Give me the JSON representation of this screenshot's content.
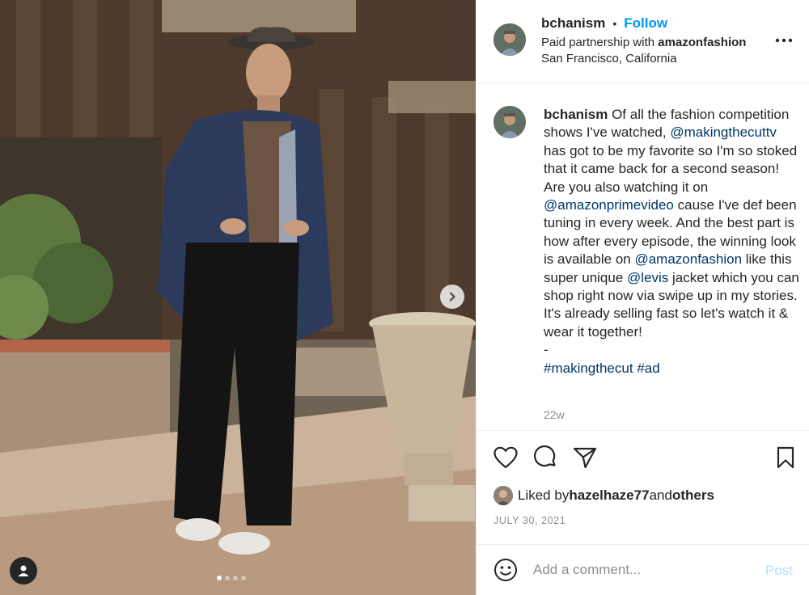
{
  "post": {
    "username": "bchanism",
    "separator": "•",
    "follow_label": "Follow",
    "partnership_prefix": "Paid partnership with ",
    "partner": "amazonfashion",
    "location": "San Francisco, California",
    "more_icon": "more-horizontal-icon"
  },
  "caption": {
    "username": "bchanism",
    "text_1": " Of all the fashion competition shows I've watched, ",
    "mention_1": "@makingthecuttv",
    "text_2": " has got to be my favorite so I'm so stoked that it came back for a second season! Are you also watching it on ",
    "mention_2": "@amazonprimevideo",
    "text_3": " cause I've def been tuning in every week. And the best part is how after every episode, the winning look is available on ",
    "mention_3": "@amazonfashion",
    "text_4": " like this super unique ",
    "mention_4": "@levis",
    "text_5": " jacket which you can shop right now via swipe up in my stories. It's already selling fast so let's watch it & wear it together!",
    "dash": "-",
    "hashtag_1": "#makingthecut",
    "hashtag_2": "#ad",
    "time_ago": "22w"
  },
  "actions": {
    "like_icon": "heart-icon",
    "comment_icon": "comment-icon",
    "share_icon": "send-icon",
    "save_icon": "bookmark-icon"
  },
  "likes": {
    "prefix": "Liked by ",
    "user": "hazelhaze77",
    "middle": " and ",
    "others": "others"
  },
  "date": "JULY 30, 2021",
  "comment_bar": {
    "placeholder": "Add a comment...",
    "post_label": "Post",
    "emoji_icon": "smiley-icon"
  },
  "carousel": {
    "slide_count": 4,
    "active_index": 0,
    "next_icon": "chevron-right-icon",
    "tag_icon": "user-tag-icon"
  },
  "colors": {
    "accent": "#0095f6",
    "mention": "#00376b",
    "muted": "#8e8e8e",
    "post_disabled": "#b2dffc"
  }
}
